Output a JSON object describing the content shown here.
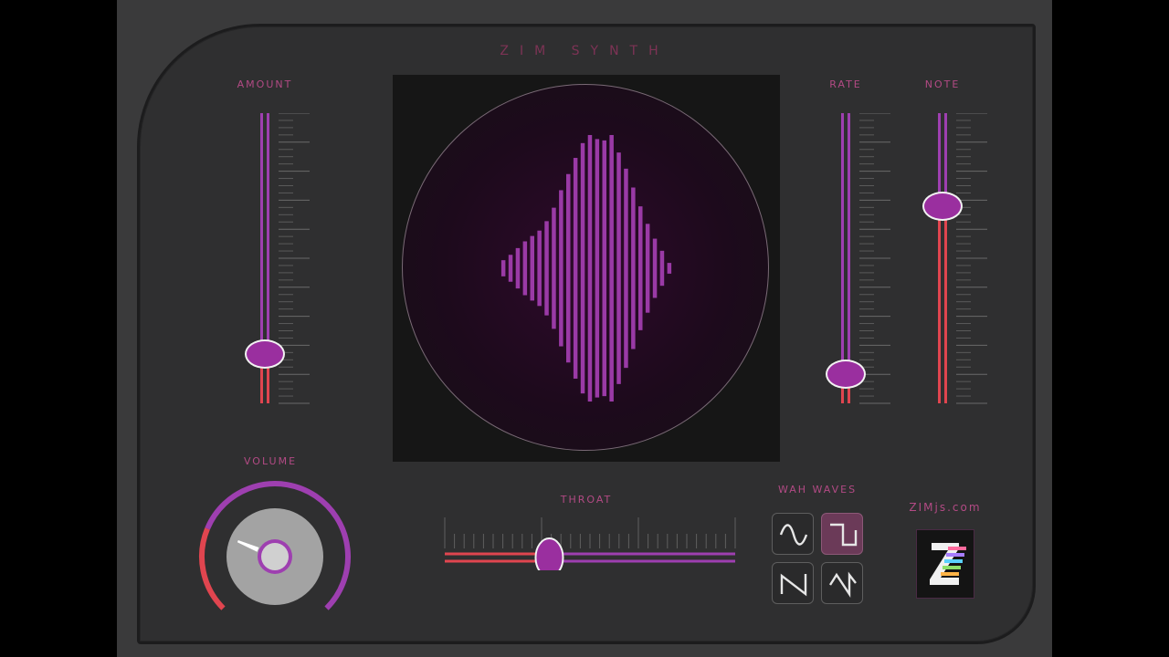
{
  "app": {
    "title": "ZIM SYNTH",
    "site": "ZIMjs.com"
  },
  "sliders": {
    "amount": {
      "label": "AMOUNT",
      "value": 0.17
    },
    "rate": {
      "label": "RATE",
      "value": 0.1
    },
    "note": {
      "label": "NOTE",
      "value": 0.68
    }
  },
  "volume": {
    "label": "VOLUME",
    "value": 0.25
  },
  "throat": {
    "label": "THROAT",
    "value": 0.36
  },
  "wah_waves": {
    "label": "WAH WAVES",
    "buttons": [
      {
        "name": "sine-wave-icon",
        "active": false
      },
      {
        "name": "square-wave-icon",
        "active": true
      },
      {
        "name": "sawtooth-wave-icon",
        "active": false
      },
      {
        "name": "reverse-sawtooth-wave-icon",
        "active": false
      }
    ]
  },
  "colors": {
    "accent": "#9e3fb0",
    "accent_dark": "#9a2f9f",
    "low": "#e0454f",
    "label": "#b24a84"
  },
  "visualizer": {
    "levels": [
      0.06,
      0.1,
      0.15,
      0.2,
      0.24,
      0.28,
      0.35,
      0.45,
      0.58,
      0.7,
      0.82,
      0.93,
      0.99,
      0.96,
      0.95,
      0.99,
      0.86,
      0.74,
      0.6,
      0.46,
      0.33,
      0.22,
      0.13,
      0.04
    ]
  }
}
